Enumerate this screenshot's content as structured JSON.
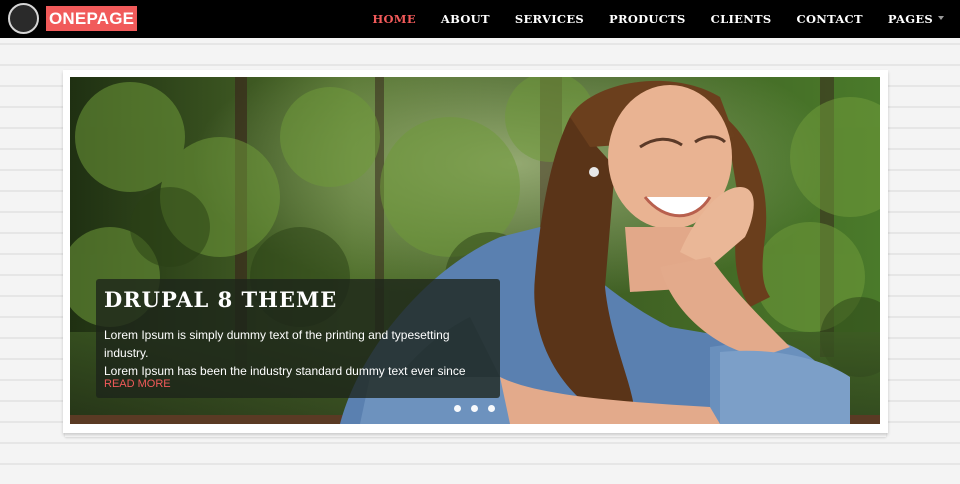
{
  "brand": {
    "name": "ONEPAGE",
    "accent_color": "#f15a5a"
  },
  "nav": {
    "items": [
      {
        "label": "HOME",
        "active": true
      },
      {
        "label": "ABOUT",
        "active": false
      },
      {
        "label": "SERVICES",
        "active": false
      },
      {
        "label": "PRODUCTS",
        "active": false
      },
      {
        "label": "CLIENTS",
        "active": false
      },
      {
        "label": "CONTACT",
        "active": false
      },
      {
        "label": "PAGES",
        "active": false,
        "has_dropdown": true
      }
    ]
  },
  "slider": {
    "title": "DRUPAL 8 THEME",
    "text_line1": "Lorem Ipsum is simply dummy text of the printing and typesetting industry.",
    "text_line2": "Lorem Ipsum has been the industry standard dummy text ever since",
    "link_label": "READ MORE",
    "slide_count": 3
  }
}
